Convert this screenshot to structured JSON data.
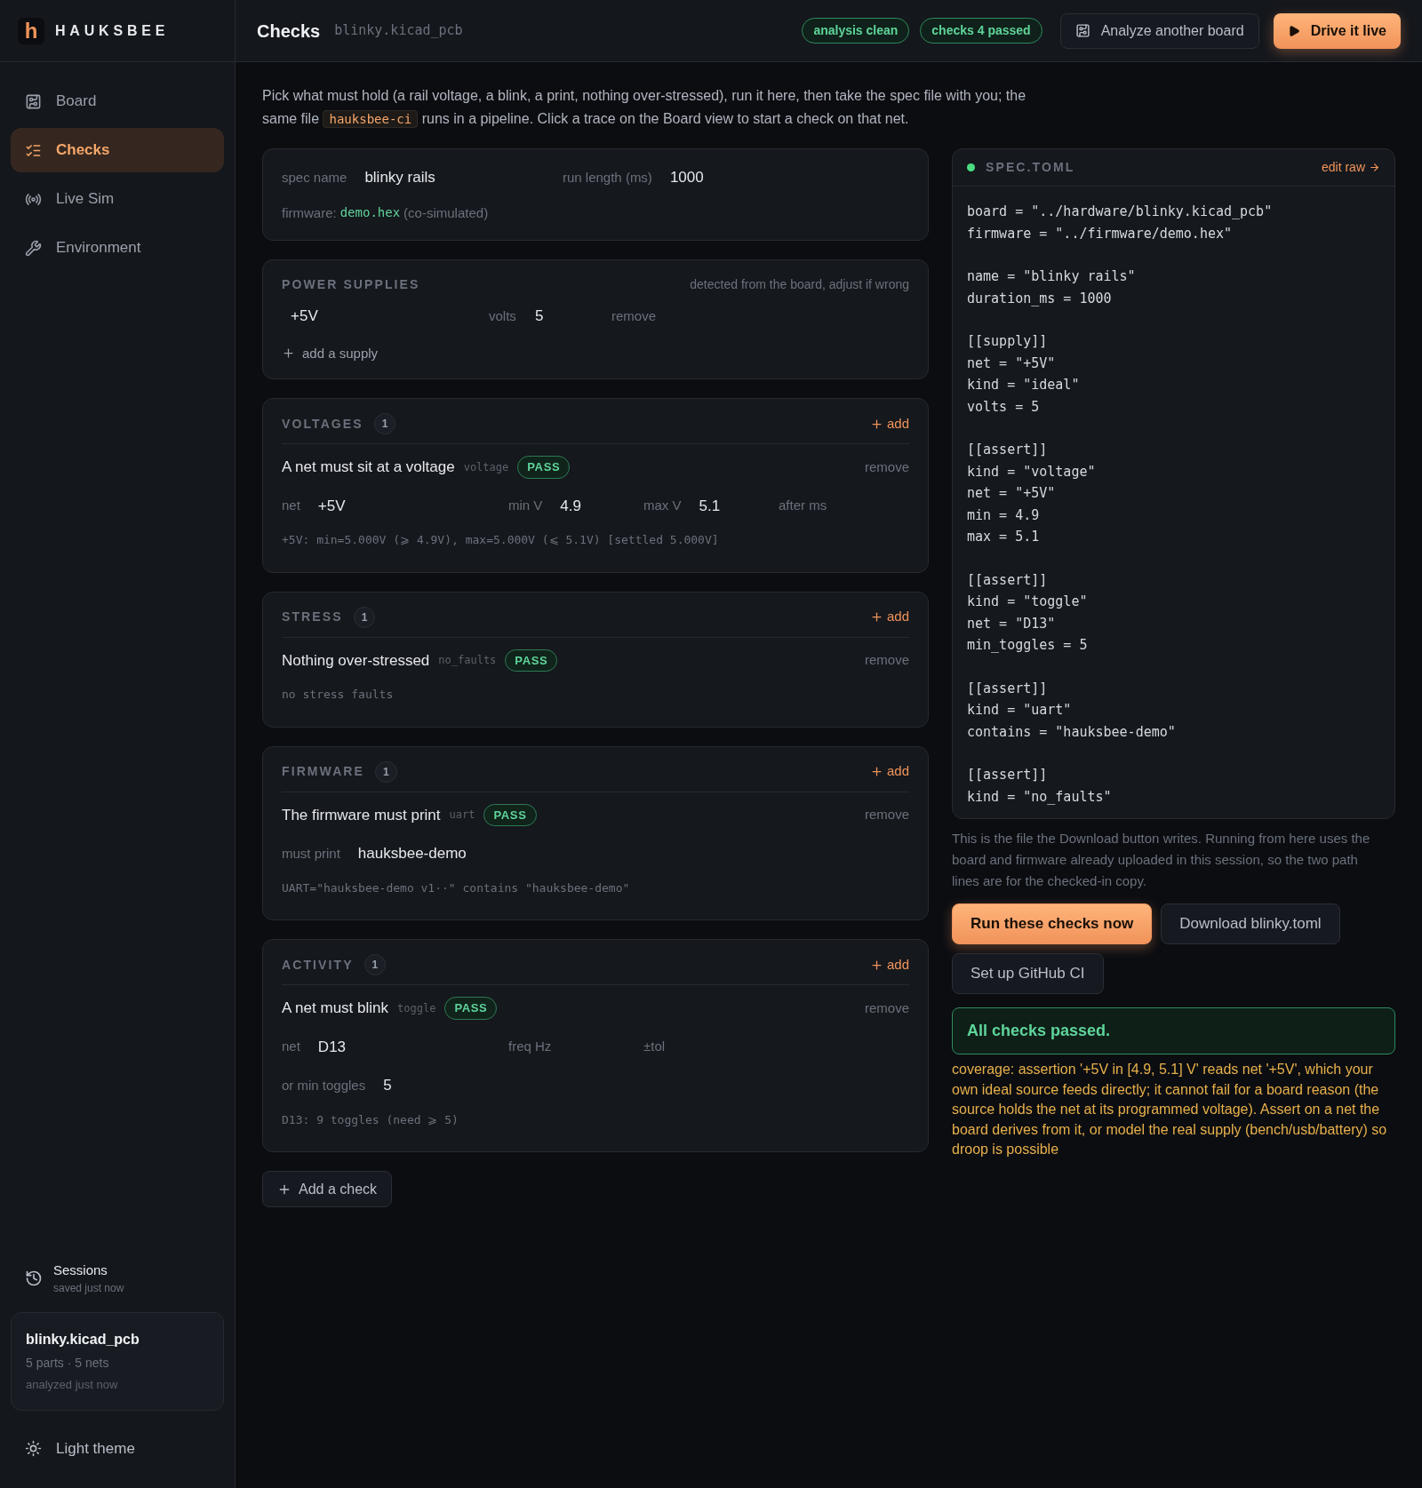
{
  "brand": {
    "logo": "h",
    "name": "HAUKSBEE"
  },
  "nav": [
    {
      "label": "Board",
      "kind": "board",
      "selected": false
    },
    {
      "label": "Checks",
      "kind": "checks",
      "selected": true
    },
    {
      "label": "Live Sim",
      "kind": "radio",
      "selected": false
    },
    {
      "label": "Environment",
      "kind": "wrench",
      "selected": false
    }
  ],
  "sessions": {
    "title": "Sessions",
    "subtitle": "saved just now",
    "card": {
      "name": "blinky.kicad_pcb",
      "meta": "5 parts · 5 nets",
      "time": "analyzed just now"
    }
  },
  "theme_toggle": "Light theme",
  "header": {
    "title": "Checks",
    "file": "blinky.kicad_pcb",
    "badges": [
      "analysis clean",
      "checks 4 passed"
    ],
    "buttons": [
      {
        "label": "Analyze another board",
        "kind": "secondary"
      },
      {
        "label": "Drive it live",
        "kind": "primary"
      }
    ]
  },
  "intro": {
    "before": "Pick what must hold (a rail voltage, a blink, a print, nothing over-stressed), run it here, then take the spec file with you; the same file",
    "code": "hauksbee-ci",
    "after": "runs in a pipeline. Click a trace on the Board view to start a check on that net."
  },
  "spec": {
    "fields": [
      {
        "label": "spec name",
        "value": "blinky rails"
      },
      {
        "label": "run length (ms)",
        "value": "1000"
      }
    ],
    "firmware": {
      "label": "firmware:",
      "file": "demo.hex",
      "note": "(co-simulated)"
    }
  },
  "supplies": {
    "title": "POWER SUPPLIES",
    "hint": "detected from the board, adjust if wrong",
    "rows": [
      {
        "net": "+5V",
        "volts_label": "volts",
        "volts": "5",
        "remove": "remove"
      }
    ],
    "add": "add a supply"
  },
  "sections": [
    {
      "title": "VOLTAGES",
      "count": "1",
      "add": "add",
      "checks": [
        {
          "title": "A net must sit at a voltage",
          "tag": "voltage",
          "status": "PASS",
          "remove": "remove",
          "field_rows": [
            [
              {
                "label": "net",
                "value": "+5V"
              },
              {
                "label": "min V",
                "value": "4.9"
              },
              {
                "label": "max V",
                "value": "5.1"
              },
              {
                "label": "after ms"
              }
            ]
          ],
          "result": "+5V: min=5.000V (⩾ 4.9V), max=5.000V (⩽ 5.1V) [settled 5.000V]"
        }
      ]
    },
    {
      "title": "STRESS",
      "count": "1",
      "add": "add",
      "checks": [
        {
          "title": "Nothing over-stressed",
          "tag": "no_faults",
          "status": "PASS",
          "remove": "remove",
          "result": "no stress faults"
        }
      ]
    },
    {
      "title": "FIRMWARE",
      "count": "1",
      "add": "add",
      "checks": [
        {
          "title": "The firmware must print",
          "tag": "uart",
          "status": "PASS",
          "remove": "remove",
          "field_rows": [
            [
              {
                "label": "must print",
                "value": "hauksbee-demo"
              }
            ]
          ],
          "result": "UART=\"hauksbee-demo v1··\" contains \"hauksbee-demo\""
        }
      ]
    },
    {
      "title": "ACTIVITY",
      "count": "1",
      "add": "add",
      "checks": [
        {
          "title": "A net must blink",
          "tag": "toggle",
          "status": "PASS",
          "remove": "remove",
          "field_rows": [
            [
              {
                "label": "net",
                "value": "D13"
              },
              {
                "label": "freq Hz"
              },
              {
                "label": "±tol"
              }
            ],
            [
              {
                "label": "or min toggles",
                "value": "5"
              }
            ]
          ],
          "result": "D13: 9 toggles (need ⩾ 5)"
        }
      ]
    }
  ],
  "add_check": "Add a check",
  "spec_file": {
    "title": "SPEC.TOML",
    "color": "#4ade80",
    "edit": "edit raw",
    "blocks": [
      [
        "board = \"../hardware/blinky.kicad_pcb\"",
        "firmware = \"../firmware/demo.hex\""
      ],
      [
        "name = \"blinky rails\"",
        "duration_ms = 1000"
      ],
      [
        "[[supply]]",
        "net = \"+5V\"",
        "kind = \"ideal\"",
        "volts = 5"
      ],
      [
        "[[assert]]",
        "kind = \"voltage\"",
        "net = \"+5V\"",
        "min = 4.9",
        "max = 5.1"
      ],
      [
        "[[assert]]",
        "kind = \"toggle\"",
        "net = \"D13\"",
        "min_toggles = 5"
      ],
      [
        "[[assert]]",
        "kind = \"uart\"",
        "contains = \"hauksbee-demo\""
      ],
      [
        "[[assert]]",
        "kind = \"no_faults\""
      ]
    ]
  },
  "note": "This is the file the Download button writes. Running from here uses the board and firmware already uploaded in this session, so the two path lines are for the checked-in copy.",
  "actions": [
    {
      "label": "Run these checks now",
      "kind": "primary"
    },
    {
      "label": "Download blinky.toml",
      "kind": "secondary"
    },
    {
      "label": "Set up GitHub CI",
      "kind": "secondary"
    }
  ],
  "result": {
    "text": "All checks passed.",
    "kind": "pass"
  },
  "warning": "coverage: assertion '+5V in [4.9, 5.1] V' reads net '+5V', which your own ideal source feeds directly; it cannot fail for a board reason (the source holds the net at its programmed voltage). Assert on a net the board derives from it, or model the real supply (bench/usb/battery) so droop is possible"
}
